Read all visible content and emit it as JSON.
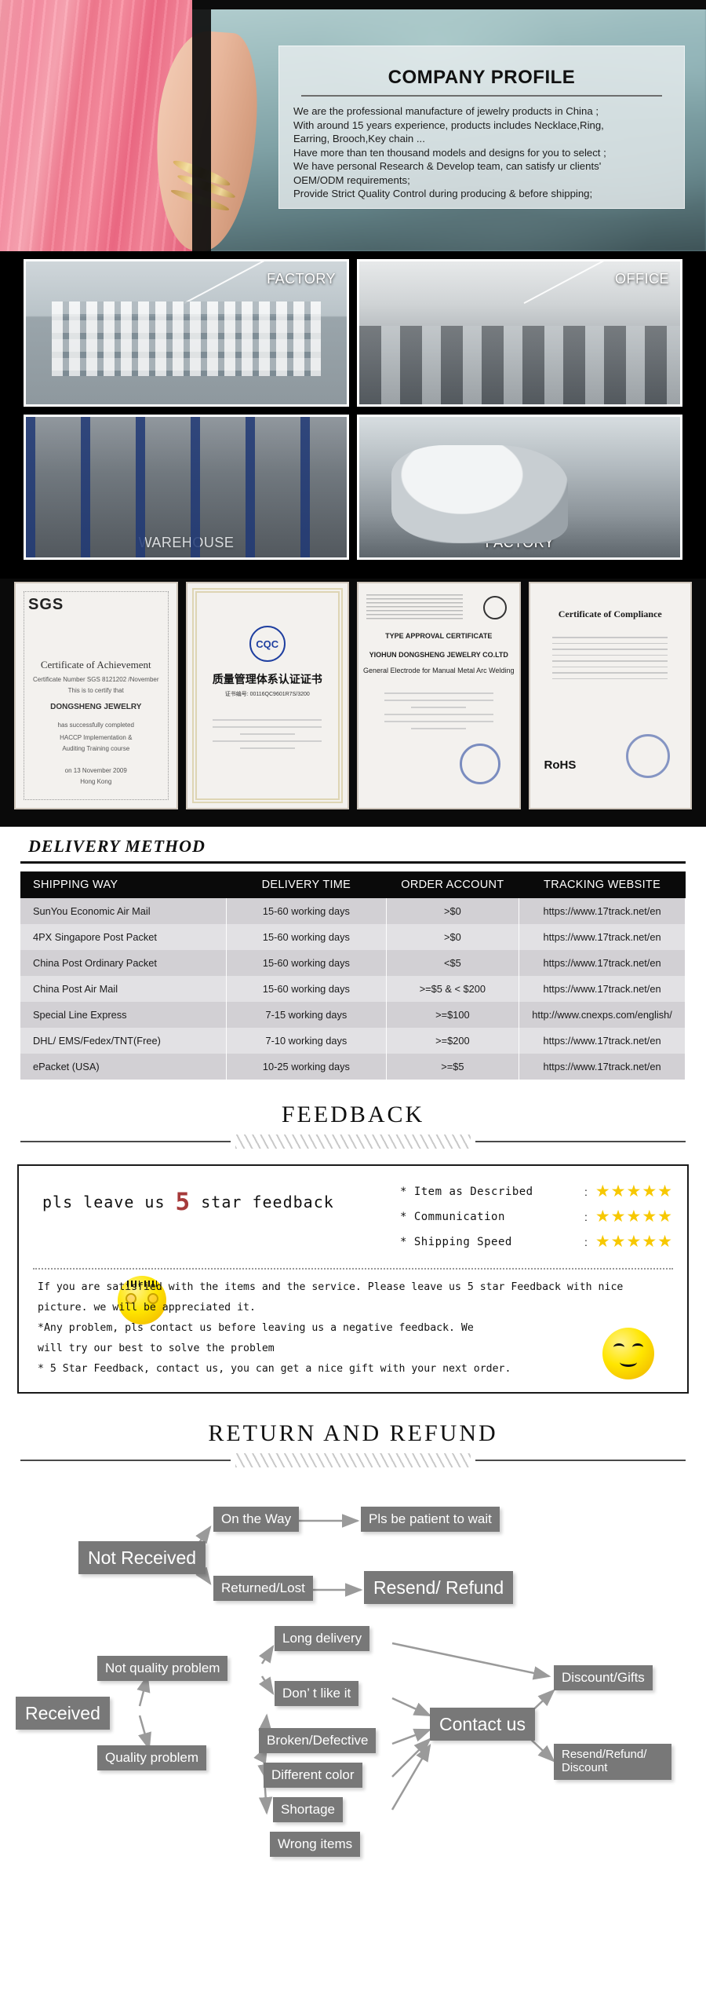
{
  "hero": {
    "profile_title": "COMPANY PROFILE",
    "profile_lines": [
      "We are the professional manufacture of jewelry products in China ;",
      "With around 15 years experience, products includes Necklace,Ring,",
      "Earring, Brooch,Key chain ...",
      "Have more than ten thousand models and designs for you to select ;",
      "We have personal Research & Develop team, can satisfy ur clients'",
      "OEM/ODM requirements;",
      "Provide Strict Quality Control during producing & before shipping;"
    ]
  },
  "photos": {
    "factory_label": "FACTORY",
    "office_label": "OFFICE",
    "warehouse_label": "WAREHOUSE",
    "factory2_label": "FACTORY"
  },
  "certificates": [
    {
      "brand": "SGS",
      "title": "Certificate of Achievement",
      "subtitle": "Certificate Number SGS 8121202 /November",
      "line": "This is to certify that",
      "holder": "DONGSHENG JEWELRY",
      "detail": "has successfully completed",
      "detail2": "HACCP Implementation &",
      "detail3": "Auditing Training course",
      "date": "on 13 November 2009",
      "place": "Hong Kong"
    },
    {
      "logo": "CQC",
      "title_cn": "质量管理体系认证证书",
      "subtitle_cn": "证书编号: 00116QC9601R7S/3200"
    },
    {
      "title": "TYPE APPROVAL CERTIFICATE",
      "holder": "YIOHUN DONGSHENG JEWELRY CO.LTD",
      "product": "General Electrode for Manual Metal Arc Welding"
    },
    {
      "title": "Certificate of Compliance",
      "mark": "RoHS"
    }
  ],
  "delivery": {
    "title": "DELIVERY METHOD",
    "columns": [
      "SHIPPING WAY",
      "DELIVERY TIME",
      "ORDER ACCOUNT",
      "TRACKING WEBSITE"
    ],
    "rows": [
      [
        "SunYou Economic Air Mail",
        "15-60 working days",
        ">$0",
        "https://www.17track.net/en"
      ],
      [
        "4PX Singapore Post Packet",
        "15-60 working days",
        ">$0",
        "https://www.17track.net/en"
      ],
      [
        "China Post Ordinary Packet",
        "15-60 working days",
        "<$5",
        "https://www.17track.net/en"
      ],
      [
        "China Post Air Mail",
        "15-60 working days",
        ">=$5 & < $200",
        "https://www.17track.net/en"
      ],
      [
        "Special Line Express",
        "7-15 working days",
        ">=$100",
        "http://www.cnexps.com/english/"
      ],
      [
        "DHL/ EMS/Fedex/TNT(Free)",
        "7-10 working days",
        ">=$200",
        "https://www.17track.net/en"
      ],
      [
        "ePacket (USA)",
        "10-25 working days",
        ">=$5",
        "https://www.17track.net/en"
      ]
    ]
  },
  "feedback": {
    "heading": "FEEDBACK",
    "slogan_pre": "pls leave us ",
    "slogan_five": "5",
    "slogan_post": " star feedback",
    "ratings": [
      {
        "label": "* Item as Described",
        "stars": "★★★★★"
      },
      {
        "label": "* Communication",
        "stars": "★★★★★"
      },
      {
        "label": "* Shipping Speed",
        "stars": "★★★★★"
      }
    ],
    "colon": ":",
    "body_lines": [
      "If you are satisfied with the items and the service. Please leave us 5 star Feedback with nice",
      "picture. we will be appreciated it.",
      "*Any problem, pls contact us before leaving us a negative feedback. We",
      "will try our best to solve  the problem",
      "* 5 Star Feedback, contact us, you can get a nice gift with your next order."
    ]
  },
  "return": {
    "heading": "RETURN  AND  REFUND",
    "nodes": {
      "not_received": "Not Received",
      "on_the_way": "On the Way",
      "pls_be_patient": "Pls be patient to wait",
      "returned_lost": "Returned/Lost",
      "resend_refund": "Resend/ Refund",
      "received": "Received",
      "not_quality_problem": "Not quality problem",
      "quality_problem": "Quality problem",
      "long_delivery": "Long delivery",
      "dont_like_it": "Don’ t like it",
      "broken_defective": "Broken/Defective",
      "different_color": "Different color",
      "shortage": "Shortage",
      "wrong_items": "Wrong items",
      "contact_us": "Contact us",
      "discount_gifts": "Discount/Gifts",
      "resend_refund_discount": "Resend/Refund/\nDiscount"
    }
  },
  "colors": {
    "node_bg": "#787878",
    "table_header_bg": "#0a0a0a",
    "row_odd": "#d2d0d4",
    "row_even": "#e2e1e4",
    "star": "#f7c800",
    "accent_red": "#a63a3a"
  }
}
